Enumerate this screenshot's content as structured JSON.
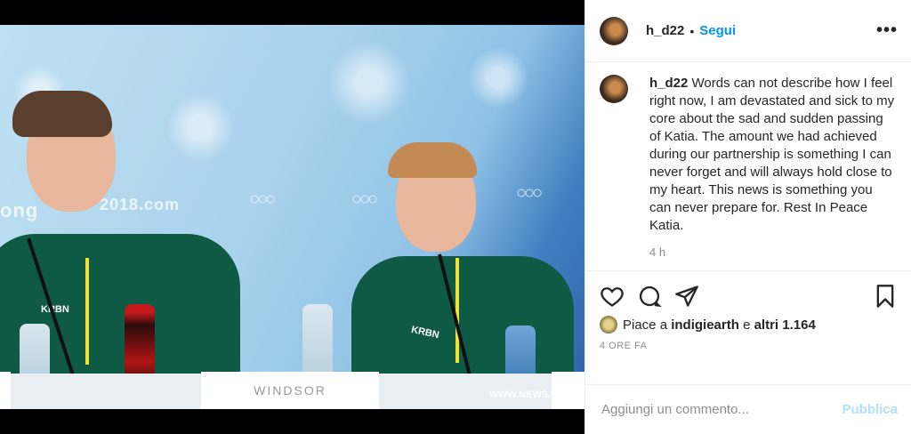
{
  "photo": {
    "background_texts": [
      "ong",
      "2018.com"
    ],
    "placard_text": "WINDSOR",
    "watermark": "WWW.NEWS.CN",
    "jacket_brand": "KRBN",
    "colors": {
      "jacket": "#0f5a45",
      "zip": "#f2e23a",
      "backdrop_light": "#bfe0f2",
      "backdrop_dark": "#2d62a8"
    }
  },
  "header": {
    "username": "h_d22",
    "separator": "•",
    "follow_label": "Segui",
    "more_icon": "more-horizontal-icon"
  },
  "caption": {
    "username": "h_d22",
    "text": "Words can not describe how I feel right now, I am devastated and sick to my core about the sad and sudden passing of Katia. The amount we had achieved during our partnership is something I can never forget and will always hold close to my heart. This news is something you can never prepare for. Rest In Peace Katia.",
    "time": "4 h"
  },
  "actions": {
    "icons": [
      "heart-icon",
      "comment-icon",
      "share-icon",
      "bookmark-icon"
    ]
  },
  "likes": {
    "prefix": "Piace a",
    "user": "indigiearth",
    "connector": "e",
    "others": "altri 1.164"
  },
  "date": "4 ORE FA",
  "comment_box": {
    "placeholder": "Aggiungi un commento...",
    "publish_label": "Pubblica"
  },
  "colors": {
    "accent": "#0095f6",
    "publish_disabled": "#b2dffc",
    "muted": "#8e8e8e"
  }
}
